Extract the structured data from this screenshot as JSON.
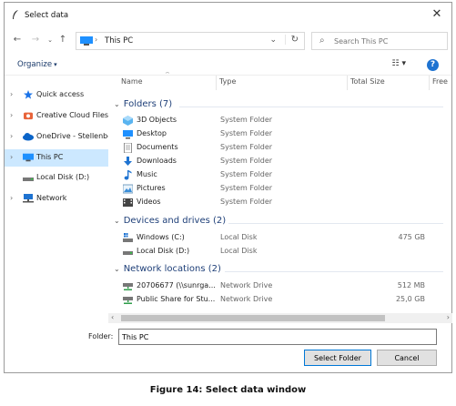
{
  "window": {
    "title": "Select data"
  },
  "nav": {
    "path": "This PC",
    "search_placeholder": "Search This PC"
  },
  "toolbar": {
    "organize": "Organize"
  },
  "sidebar": {
    "items": [
      {
        "label": "Quick access",
        "icon": "star-icon"
      },
      {
        "label": "Creative Cloud Files",
        "icon": "creative-cloud-icon"
      },
      {
        "label": "OneDrive - Stellenbos",
        "icon": "cloud-icon"
      },
      {
        "label": "This PC",
        "icon": "computer-icon",
        "selected": true
      },
      {
        "label": "Local Disk (D:)",
        "icon": "drive-icon"
      },
      {
        "label": "Network",
        "icon": "network-icon"
      }
    ]
  },
  "columns": {
    "name": "Name",
    "type": "Type",
    "size": "Total Size",
    "free": "Free"
  },
  "groups": {
    "folders": {
      "title": "Folders (7)",
      "items": [
        {
          "name": "3D Objects",
          "type": "System Folder",
          "icon": "3d-objects-icon"
        },
        {
          "name": "Desktop",
          "type": "System Folder",
          "icon": "desktop-icon"
        },
        {
          "name": "Documents",
          "type": "System Folder",
          "icon": "documents-icon"
        },
        {
          "name": "Downloads",
          "type": "System Folder",
          "icon": "downloads-icon"
        },
        {
          "name": "Music",
          "type": "System Folder",
          "icon": "music-icon"
        },
        {
          "name": "Pictures",
          "type": "System Folder",
          "icon": "pictures-icon"
        },
        {
          "name": "Videos",
          "type": "System Folder",
          "icon": "videos-icon"
        }
      ]
    },
    "drives": {
      "title": "Devices and drives (2)",
      "items": [
        {
          "name": "Windows (C:)",
          "type": "Local Disk",
          "size": "475 GB",
          "icon": "windows-drive-icon"
        },
        {
          "name": "Local Disk (D:)",
          "type": "Local Disk",
          "size": "",
          "icon": "drive-icon"
        }
      ]
    },
    "network": {
      "title": "Network locations (2)",
      "items": [
        {
          "name": "20706677 (\\\\sunrga...",
          "type": "Network Drive",
          "size": "512 MB",
          "icon": "network-drive-icon"
        },
        {
          "name": "Public Share for Stu...",
          "type": "Network Drive",
          "size": "25,0 GB",
          "icon": "network-drive-icon"
        }
      ]
    }
  },
  "footer": {
    "folder_label": "Folder:",
    "folder_value": "This PC",
    "select_button": "Select Folder",
    "cancel_button": "Cancel"
  },
  "caption": "Figure 14: Select data window",
  "colors": {
    "accent": "#0078d7",
    "selection": "#cce8ff",
    "group_title": "#1e3f78"
  }
}
